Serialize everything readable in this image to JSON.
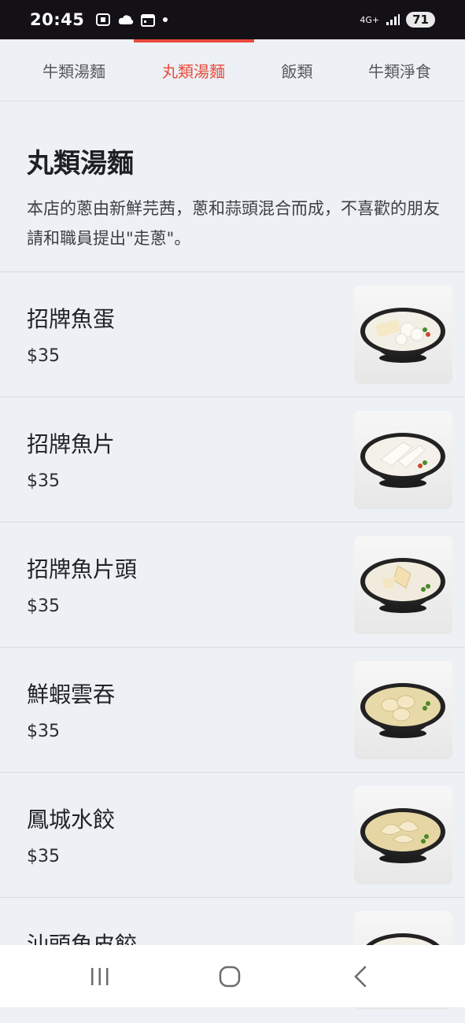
{
  "status_bar": {
    "time": "20:45",
    "network": "4G+",
    "battery": "71",
    "icons": [
      "screenshot-icon",
      "cloud-icon",
      "calendar-icon",
      "dot-icon",
      "signal-icon"
    ]
  },
  "tabs": [
    {
      "label": "牛類湯麵"
    },
    {
      "label": "丸類湯麵"
    },
    {
      "label": "飯類"
    },
    {
      "label": "牛類淨食"
    }
  ],
  "active_tab": "丸類湯麵",
  "section": {
    "title": "丸類湯麵",
    "description": "本店的蔥由新鮮芫茜，蔥和蒜頭混合而成，不喜歡的朋友請和職員提出\"走蔥\"。"
  },
  "items": [
    {
      "name": "招牌魚蛋",
      "price": "$35"
    },
    {
      "name": "招牌魚片",
      "price": "$35"
    },
    {
      "name": "招牌魚片頭",
      "price": "$35"
    },
    {
      "name": "鮮蝦雲吞",
      "price": "$35"
    },
    {
      "name": "鳳城水餃",
      "price": "$35"
    },
    {
      "name": "汕頭魚皮餃",
      "price": ""
    }
  ],
  "colors": {
    "accent": "#e84b3c",
    "background": "#edf1f5",
    "status_bar": "#141116"
  }
}
